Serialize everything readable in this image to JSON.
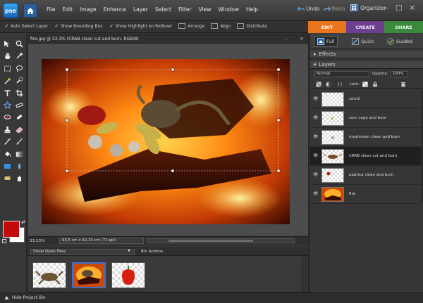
{
  "app": {
    "logo_text": "pse",
    "menus": [
      "File",
      "Edit",
      "Image",
      "Enhance",
      "Layer",
      "Select",
      "Filter",
      "View",
      "Window",
      "Help"
    ],
    "undo_label": "Undo",
    "redo_label": "Redo",
    "organizer_label": "Organizer",
    "window_buttons": [
      "–",
      "□",
      "×"
    ]
  },
  "options_bar": {
    "auto_select": "Auto Select Layer",
    "show_bounding": "Show Bounding Box",
    "show_highlight": "Show Highlight on Rollover",
    "arrange": "Arrange",
    "align": "Align",
    "distribute": "Distribute"
  },
  "mode_tabs": {
    "edit": "EDIT",
    "create": "CREATE",
    "share": "SHARE"
  },
  "document": {
    "title": "fire.jpg @ 33,3% (CRAB clean cut and burn, RGB/8)",
    "zoom": "33,33%",
    "size": "63,5 cm x 42,33 cm (72 ppi)"
  },
  "colors": {
    "foreground": "#c50a0a",
    "background": "#ffffff",
    "edit_tab": "#e8741c",
    "create_tab": "#6f3f8f",
    "share_tab": "#3b8a3c"
  },
  "project_bin": {
    "show_select": "Show Open Files",
    "actions_label": "Bin Actions",
    "hide_label": "Hide Project Bin",
    "thumbnails": [
      "crab",
      "fire-composite",
      "paprika"
    ]
  },
  "right_panel": {
    "modes": {
      "full": "Full",
      "quick": "Quick",
      "guided": "Guided"
    },
    "effects_label": "Effects",
    "layers_label": "Layers",
    "blend_mode": "Normal",
    "opacity_label": "Opacity:",
    "opacity_value": "100%",
    "lock_label": "Lock:",
    "layers": [
      {
        "name": "corn2",
        "selected": false
      },
      {
        "name": "corn copy and burn",
        "selected": false
      },
      {
        "name": "mushroom clean and burn",
        "selected": false
      },
      {
        "name": "CRAB clean cut and burn",
        "selected": true
      },
      {
        "name": "paprica clean and burn",
        "selected": false
      },
      {
        "name": "fire",
        "selected": false
      }
    ]
  },
  "tools": [
    "move-tool",
    "zoom-tool",
    "hand-tool",
    "eyedropper-tool",
    "marquee-tool",
    "lasso-tool",
    "magic-wand-tool",
    "quick-selection-tool",
    "type-tool",
    "crop-tool",
    "cookie-cutter-tool",
    "straighten-tool",
    "red-eye-tool",
    "spot-healing-tool",
    "clone-stamp-tool",
    "eraser-tool",
    "brush-tool",
    "smart-brush-tool",
    "paint-bucket-tool",
    "gradient-tool",
    "shape-tool",
    "blur-tool",
    "sponge-tool",
    "smudge-tool"
  ]
}
